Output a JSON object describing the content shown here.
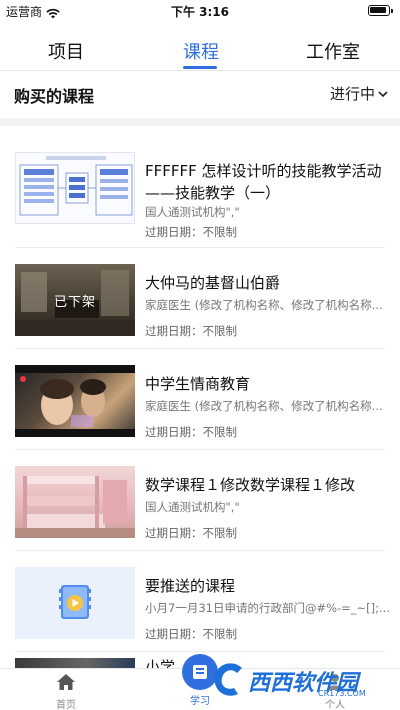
{
  "status_bar": {
    "carrier": "运营商",
    "time": "下午 3:16"
  },
  "tabs": [
    {
      "label": "项目",
      "active": false
    },
    {
      "label": "课程",
      "active": true
    },
    {
      "label": "工作室",
      "active": false
    }
  ],
  "section": {
    "title": "购买的课程",
    "filter": "进行中"
  },
  "courses": [
    {
      "title": "FFFFFF 怎样设计听的技能教学活动——技能教学（一）",
      "subtitle": "国人通测试机构\",\"",
      "expiry": "过期日期：不限制",
      "thumb": "diagram"
    },
    {
      "title": "大仲马的基督山伯爵",
      "subtitle": "家庭医生 (修改了机构名称、修改了机构名称...",
      "expiry": "过期日期：不限制",
      "thumb": "room",
      "overlay": "已下架"
    },
    {
      "title": "中学生情商教育",
      "subtitle": "家庭医生 (修改了机构名称、修改了机构名称...",
      "expiry": "过期日期：不限制",
      "thumb": "video"
    },
    {
      "title": "数学课程１修改数学课程１修改",
      "subtitle": "国人通测试机构\",\"",
      "expiry": "过期日期：不限制",
      "thumb": "pink"
    },
    {
      "title": "要推送的课程",
      "subtitle": "小月7一月31日申请的行政部门@#%-=_~[];...",
      "expiry": "过期日期：不限制",
      "thumb": "video-icon"
    }
  ],
  "partial_item": {
    "title": "小学..."
  },
  "bottom_nav": [
    {
      "label": "首页",
      "icon": "home-icon",
      "active": false
    },
    {
      "label": "学习",
      "icon": "book-icon",
      "active": true
    },
    {
      "label": "个人",
      "icon": "person-icon",
      "active": false
    }
  ],
  "watermark": {
    "text": "西西软件园",
    "url": "CR173.COM"
  },
  "colors": {
    "accent": "#2f6fe0",
    "divider": "#ececec"
  }
}
